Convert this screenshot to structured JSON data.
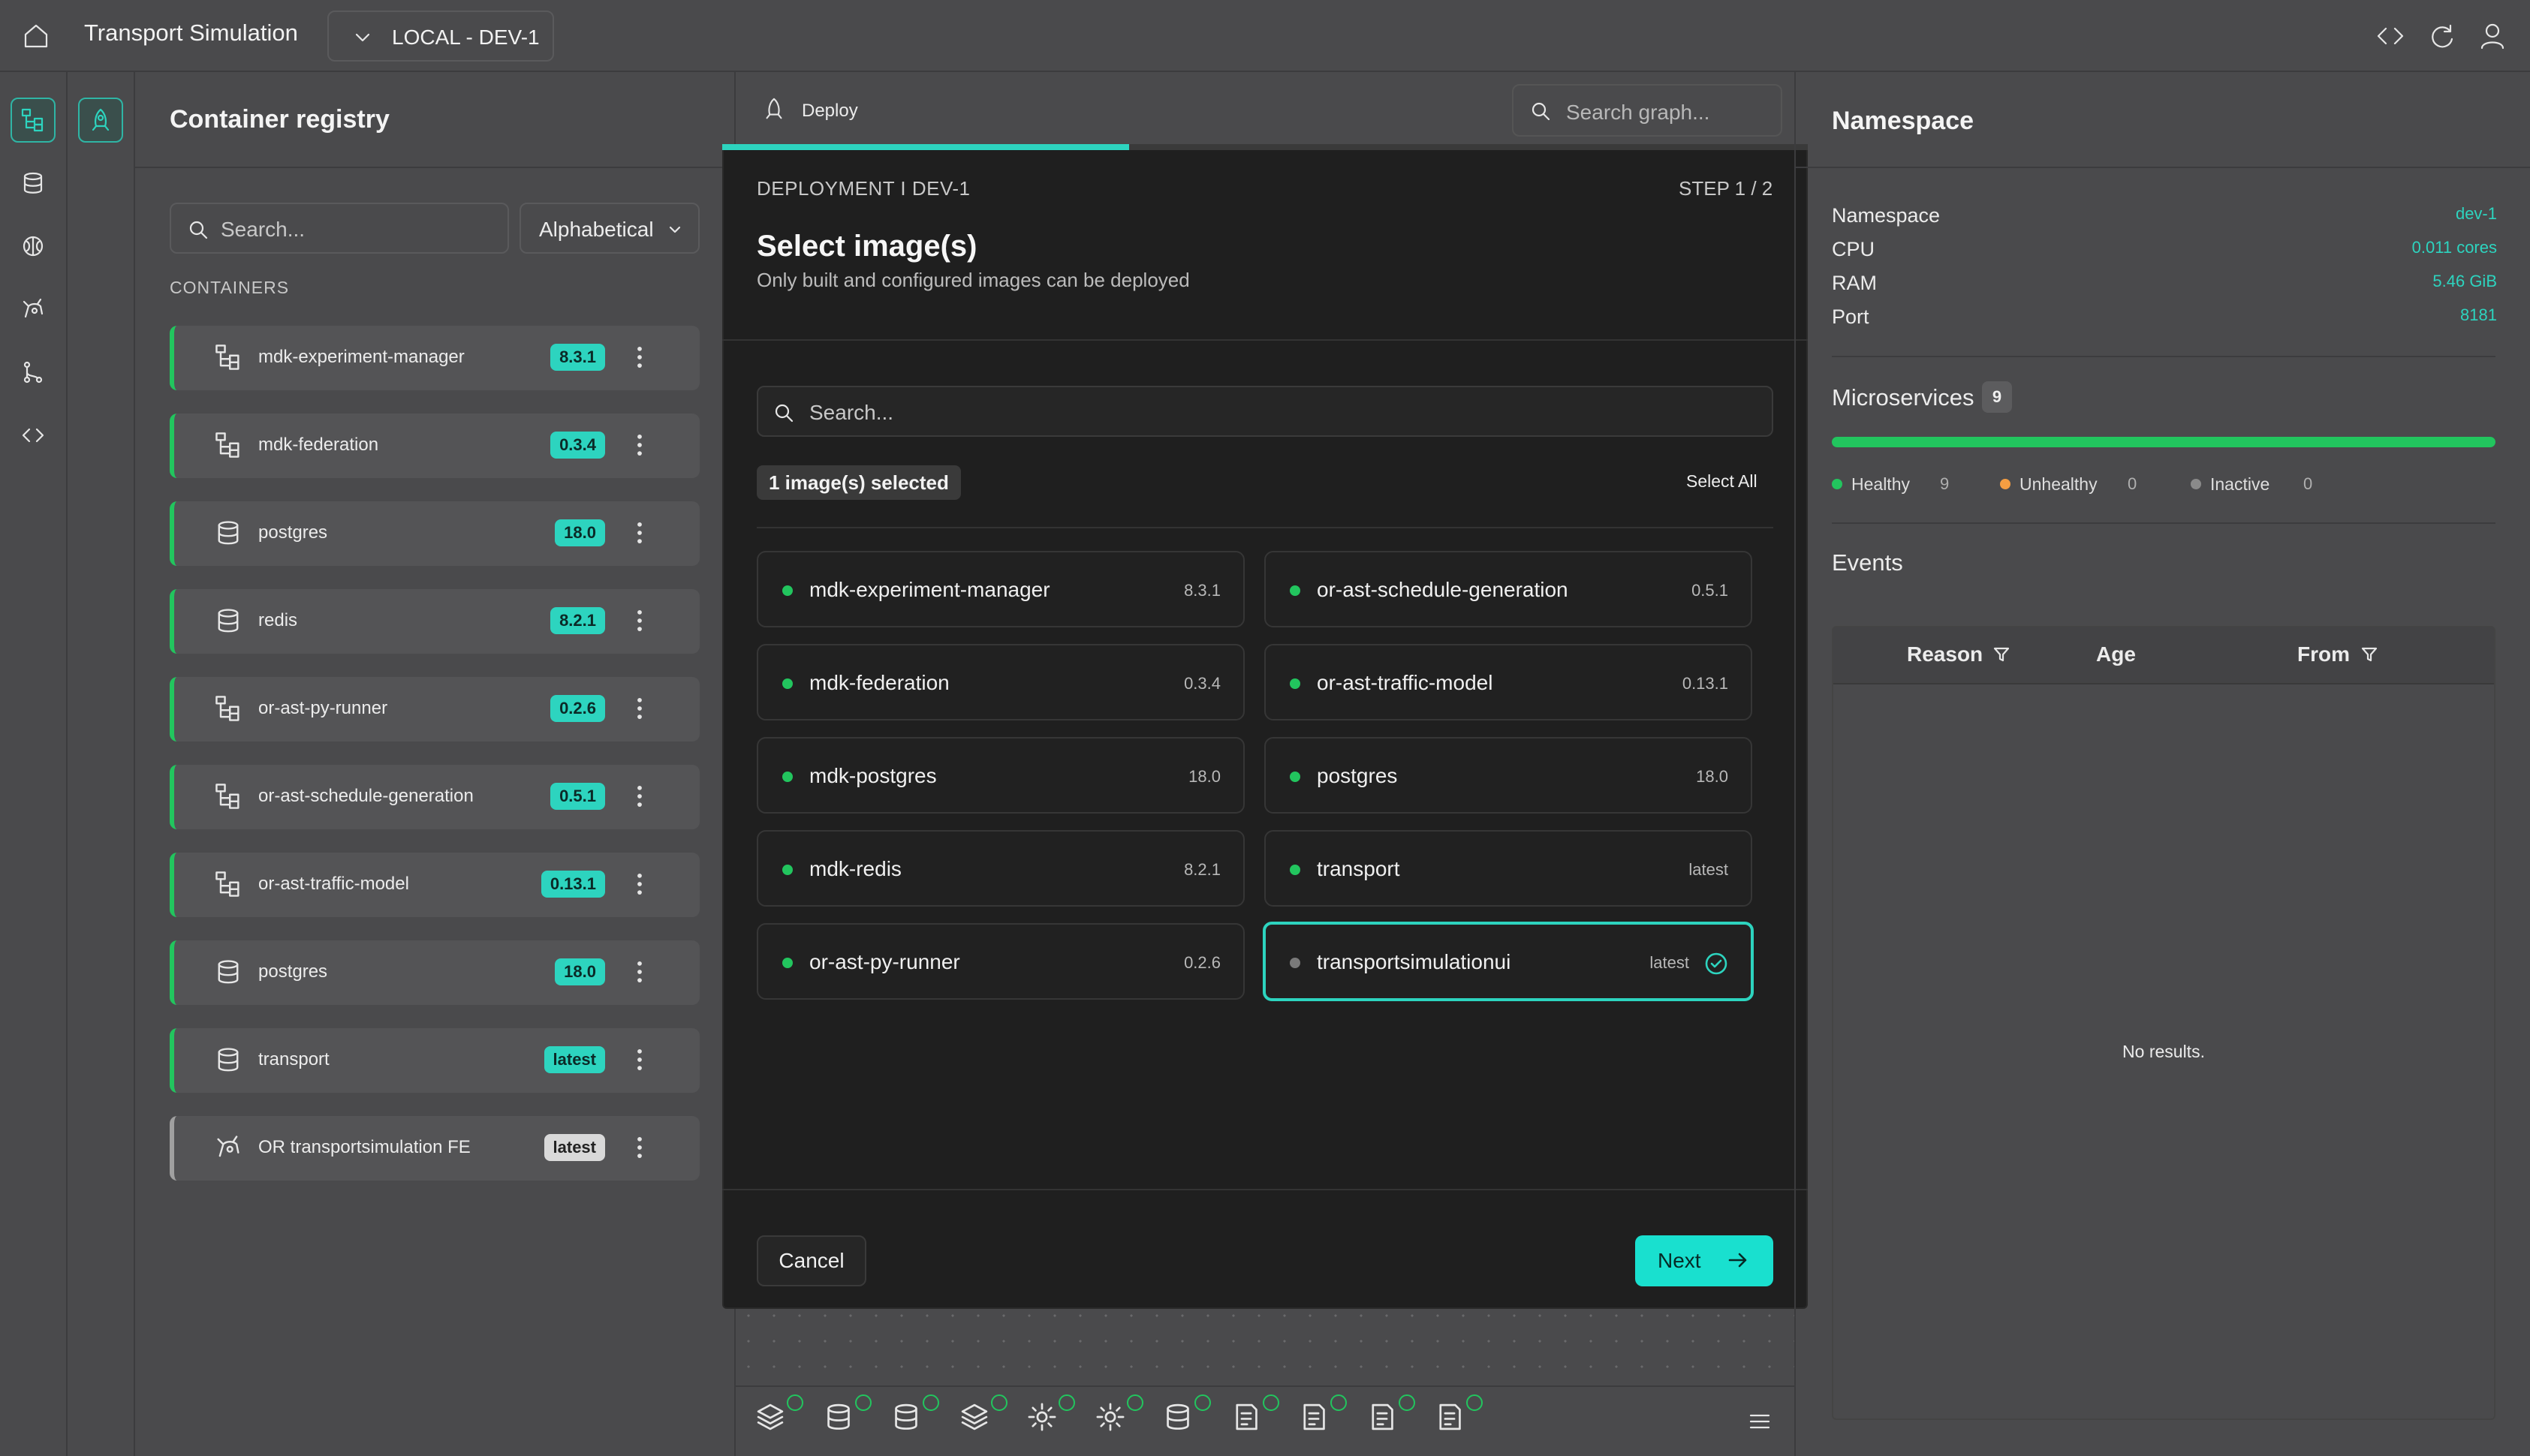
{
  "topbar": {
    "app_title": "Transport Simulation",
    "environment": "LOCAL - DEV-1",
    "icons": [
      "home-icon",
      "code-icon",
      "refresh-icon",
      "user-icon"
    ]
  },
  "rail": {
    "items": [
      "graph-icon",
      "database-icon",
      "brain-icon",
      "robot-icon",
      "git-branch-icon",
      "code-icon"
    ],
    "secondary": [
      "deploy-rocket-icon"
    ]
  },
  "registry": {
    "title": "Container registry",
    "search_placeholder": "Search...",
    "sort": "Alphabetical",
    "section_label": "CONTAINERS",
    "containers": [
      {
        "name": "mdk-experiment-manager",
        "version": "8.3.1",
        "icon": "hierarchy-icon"
      },
      {
        "name": "mdk-federation",
        "version": "0.3.4",
        "icon": "hierarchy-icon"
      },
      {
        "name": "postgres",
        "version": "18.0",
        "icon": "database-icon"
      },
      {
        "name": "redis",
        "version": "8.2.1",
        "icon": "database-icon"
      },
      {
        "name": "or-ast-py-runner",
        "version": "0.2.6",
        "icon": "hierarchy-icon"
      },
      {
        "name": "or-ast-schedule-generation",
        "version": "0.5.1",
        "icon": "hierarchy-icon"
      },
      {
        "name": "or-ast-traffic-model",
        "version": "0.13.1",
        "icon": "hierarchy-icon"
      },
      {
        "name": "postgres",
        "version": "18.0",
        "icon": "database-icon"
      },
      {
        "name": "transport",
        "version": "latest",
        "icon": "database-icon"
      },
      {
        "name": "OR transportsimulation FE",
        "version": "latest",
        "icon": "robot-icon"
      }
    ]
  },
  "center": {
    "tab_label": "Deploy",
    "graph_search_placeholder": "Search graph..."
  },
  "modal": {
    "context": "DEPLOYMENT I DEV-1",
    "step": "STEP 1 / 2",
    "progress": 0.5,
    "title": "Select image(s)",
    "subtitle": "Only built and configured images can be deployed",
    "search_placeholder": "Search...",
    "selected_text": "1 image(s) selected",
    "select_all": "Select All",
    "images": [
      {
        "name": "mdk-experiment-manager",
        "version": "8.3.1",
        "status": "healthy",
        "selected": false
      },
      {
        "name": "or-ast-schedule-generation",
        "version": "0.5.1",
        "status": "healthy",
        "selected": false
      },
      {
        "name": "mdk-federation",
        "version": "0.3.4",
        "status": "healthy",
        "selected": false
      },
      {
        "name": "or-ast-traffic-model",
        "version": "0.13.1",
        "status": "healthy",
        "selected": false
      },
      {
        "name": "mdk-postgres",
        "version": "18.0",
        "status": "healthy",
        "selected": false
      },
      {
        "name": "postgres",
        "version": "18.0",
        "status": "healthy",
        "selected": false
      },
      {
        "name": "mdk-redis",
        "version": "8.2.1",
        "status": "healthy",
        "selected": false
      },
      {
        "name": "transport",
        "version": "latest",
        "status": "healthy",
        "selected": false
      },
      {
        "name": "or-ast-py-runner",
        "version": "0.2.6",
        "status": "healthy",
        "selected": false
      },
      {
        "name": "transportsimulationui",
        "version": "latest",
        "status": "inactive",
        "selected": true
      }
    ],
    "cancel_label": "Cancel",
    "next_label": "Next"
  },
  "namespace": {
    "title": "Namespace",
    "fields": [
      {
        "key": "Namespace",
        "value": "dev-1"
      },
      {
        "key": "CPU",
        "value": "0.011 cores"
      },
      {
        "key": "RAM",
        "value": "5.46 GiB"
      },
      {
        "key": "Port",
        "value": "8181"
      }
    ],
    "microservices_label": "Microservices",
    "microservices_count": "9",
    "healthy_fraction": 1.0,
    "legend": [
      {
        "label": "Healthy",
        "count": "9",
        "color": "#22c55e"
      },
      {
        "label": "Unhealthy",
        "count": "0",
        "color": "#f59e42"
      },
      {
        "label": "Inactive",
        "count": "0",
        "color": "#8a8a8a"
      }
    ],
    "events_label": "Events",
    "events_columns": [
      "Reason",
      "Age",
      "From"
    ],
    "events_empty": "No results."
  },
  "graph_nodes": [
    "layers-icon",
    "database-icon",
    "database-icon",
    "layers-icon",
    "gear-icon",
    "gear-icon",
    "database-icon",
    "document-icon",
    "document-icon",
    "document-icon",
    "document-icon"
  ],
  "colors": {
    "accent": "#2dd4bf",
    "healthy": "#22c55e",
    "modal_bg": "#1f1f1f",
    "page_bg": "#4a4a4c"
  }
}
